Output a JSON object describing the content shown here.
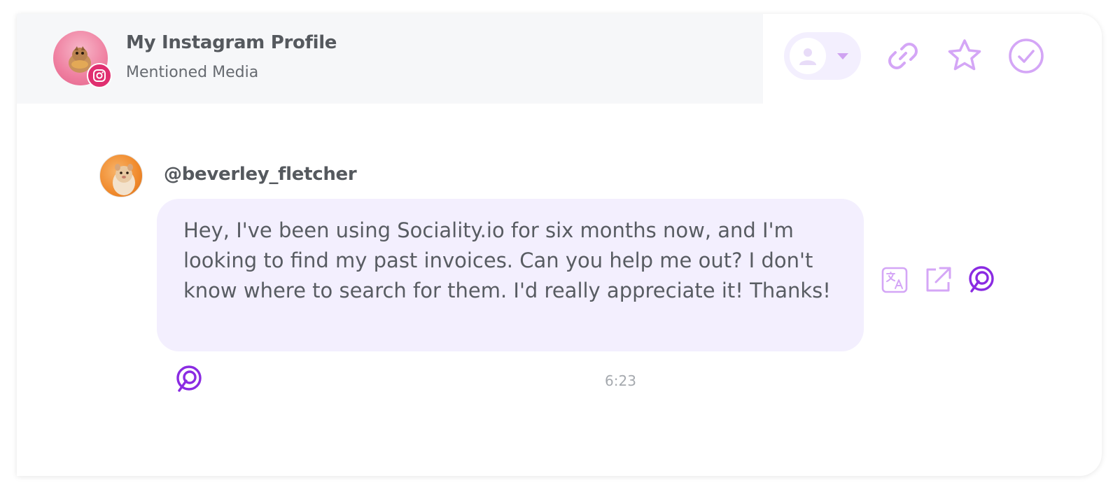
{
  "profile": {
    "title": "My Instagram Profile",
    "subtitle": "Mentioned Media",
    "avatar_icon": "chipmunk-avatar",
    "platform_badge_icon": "instagram-icon"
  },
  "header_actions": {
    "assign_icon": "user-icon",
    "assign_caret_icon": "caret-down-icon",
    "link_icon": "link-icon",
    "favorite_icon": "star-icon",
    "done_icon": "check-circle-icon"
  },
  "message": {
    "author": "@beverley_fletcher",
    "author_avatar_icon": "hamster-avatar",
    "text": "Hey, I've been using Sociality.io for six months now, and I'm looking to find my past invoices. Can you help me out? I don't know where to search for them. I'd really appreciate it! Thanks!",
    "time": "6:23",
    "actions": [
      "translate-icon",
      "open-external-icon",
      "sociality-icon"
    ],
    "footer_icon": "sociality-icon"
  },
  "colors": {
    "accent_light": "#d4a6f6",
    "accent_dark": "#8a2be2",
    "bubble_bg": "#f3effe",
    "header_bg": "#f6f7f9",
    "instagram_badge": "#e02f70"
  }
}
